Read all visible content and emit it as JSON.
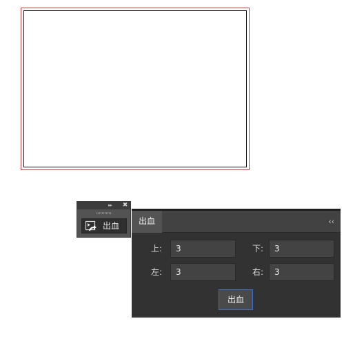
{
  "colors": {
    "bleed_line": "#d9383f",
    "trim_line": "#111111",
    "panel_bg": "#323232",
    "accent_border": "#3d6dcc"
  },
  "mini_panel": {
    "expand_icon": "double-chevron-right-icon",
    "expand_glyph": "▸▸",
    "close_icon": "close-icon",
    "close_glyph": "✖",
    "button_icon": "image-export-icon",
    "button_label": "出血"
  },
  "panel": {
    "tab_label": "出血",
    "collapse_icon": "double-chevron-left-icon",
    "collapse_glyph": "‹‹",
    "fields": {
      "top": {
        "label": "上:",
        "value": "3"
      },
      "bottom": {
        "label": "下:",
        "value": "3"
      },
      "left": {
        "label": "左:",
        "value": "3"
      },
      "right": {
        "label": "右:",
        "value": "3"
      }
    },
    "apply_label": "出血"
  }
}
